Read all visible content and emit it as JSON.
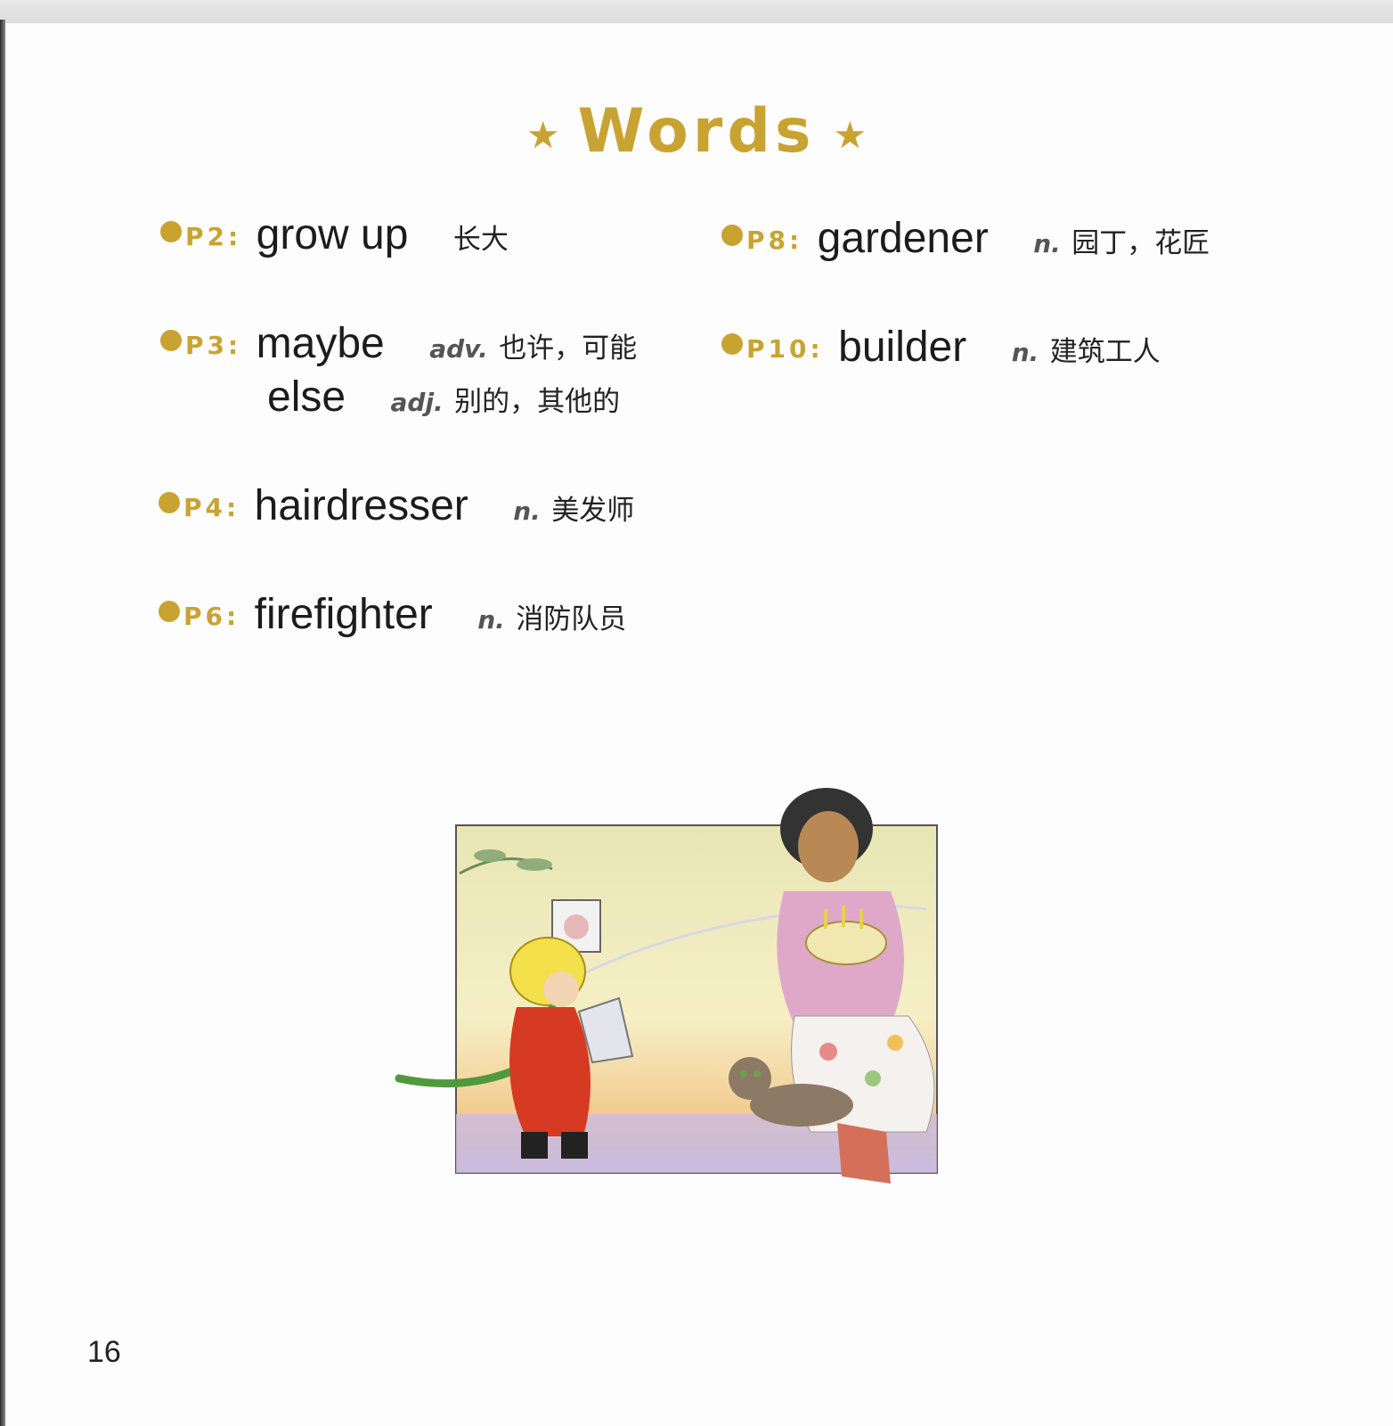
{
  "title": {
    "text": "Words",
    "star": "★"
  },
  "bullet_color": "#c9a332",
  "entries": [
    {
      "page": "P2:",
      "term": "grow up",
      "pos": "",
      "meaning": "长大"
    },
    {
      "page": "P3:",
      "term": "maybe",
      "pos": "adv.",
      "meaning": "也许，可能"
    },
    {
      "page": "",
      "term": "else",
      "pos": "adj.",
      "meaning": "别的，其他的"
    },
    {
      "page": "P4:",
      "term": "hairdresser",
      "pos": "n.",
      "meaning": "美发师"
    },
    {
      "page": "P6:",
      "term": "firefighter",
      "pos": "n.",
      "meaning": "消防队员"
    },
    {
      "page": "P8:",
      "term": "gardener",
      "pos": "n.",
      "meaning": "园丁，花匠"
    },
    {
      "page": "P10:",
      "term": "builder",
      "pos": "n.",
      "meaning": "建筑工人"
    }
  ],
  "illustration": {
    "subject": "girl-firefighter-with-bucket-woman-with-birthday-cake-cat"
  },
  "page_number": "16"
}
